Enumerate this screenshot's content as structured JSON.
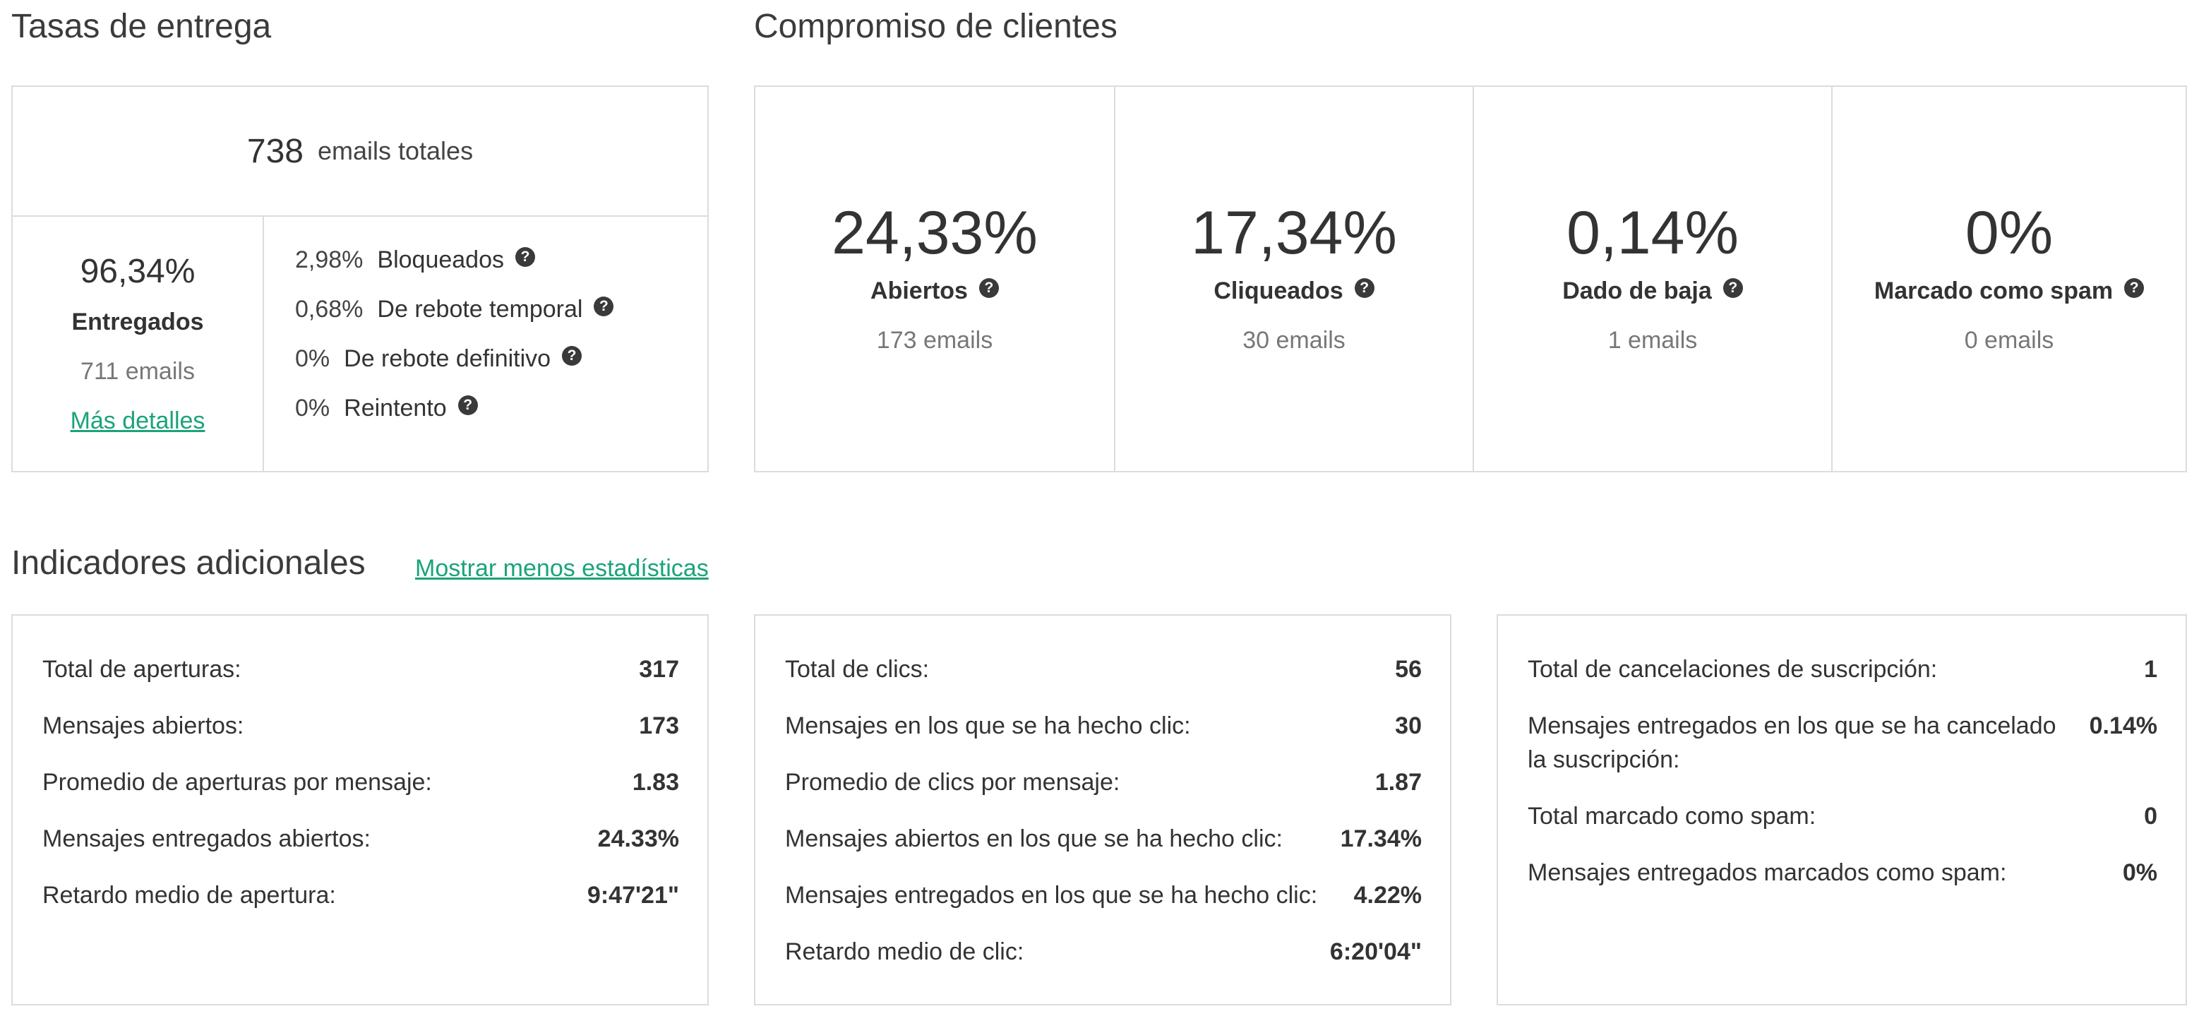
{
  "delivery": {
    "title": "Tasas de entrega",
    "total_count": "738",
    "total_label": "emails totales",
    "delivered_pct": "96,34%",
    "delivered_label": "Entregados",
    "delivered_emails": "711 emails",
    "more_details": "Más detalles",
    "items": [
      {
        "pct": "2,98%",
        "label": "Bloqueados"
      },
      {
        "pct": "0,68%",
        "label": "De rebote temporal"
      },
      {
        "pct": "0%",
        "label": "De rebote definitivo"
      },
      {
        "pct": "0%",
        "label": "Reintento"
      }
    ]
  },
  "engagement": {
    "title": "Compromiso de clientes",
    "cells": [
      {
        "pct": "24,33%",
        "label": "Abiertos",
        "emails": "173 emails"
      },
      {
        "pct": "17,34%",
        "label": "Cliqueados",
        "emails": "30 emails"
      },
      {
        "pct": "0,14%",
        "label": "Dado de baja",
        "emails": "1 emails"
      },
      {
        "pct": "0%",
        "label": "Marcado como spam",
        "emails": "0 emails"
      }
    ]
  },
  "additional": {
    "title": "Indicadores adicionales",
    "toggle_link": "Mostrar menos estadísticas",
    "opens": [
      {
        "label": "Total de aperturas:",
        "value": "317"
      },
      {
        "label": "Mensajes abiertos:",
        "value": "173"
      },
      {
        "label": "Promedio de aperturas por mensaje:",
        "value": "1.83"
      },
      {
        "label": "Mensajes entregados abiertos:",
        "value": "24.33%"
      },
      {
        "label": "Retardo medio de apertura:",
        "value": "9:47'21\""
      }
    ],
    "clicks": [
      {
        "label": "Total de clics:",
        "value": "56"
      },
      {
        "label": "Mensajes en los que se ha hecho clic:",
        "value": "30"
      },
      {
        "label": "Promedio de clics por mensaje:",
        "value": "1.87"
      },
      {
        "label": "Mensajes abiertos en los que se ha hecho clic:",
        "value": "17.34%"
      },
      {
        "label": "Mensajes entregados en los que se ha hecho clic:",
        "value": "4.22%"
      },
      {
        "label": "Retardo medio de clic:",
        "value": "6:20'04\""
      }
    ],
    "unsubs": [
      {
        "label": "Total de cancelaciones de suscripción:",
        "value": "1"
      },
      {
        "label": "Mensajes entregados en los que se ha cancelado la suscripción:",
        "value": "0.14%"
      },
      {
        "label": "Total marcado como spam:",
        "value": "0"
      },
      {
        "label": "Mensajes entregados marcados como spam:",
        "value": "0%"
      }
    ]
  },
  "colors": {
    "accent_link": "#1aa37a",
    "icon_bg": "#3a3a3a",
    "border": "#dcdcdc"
  }
}
